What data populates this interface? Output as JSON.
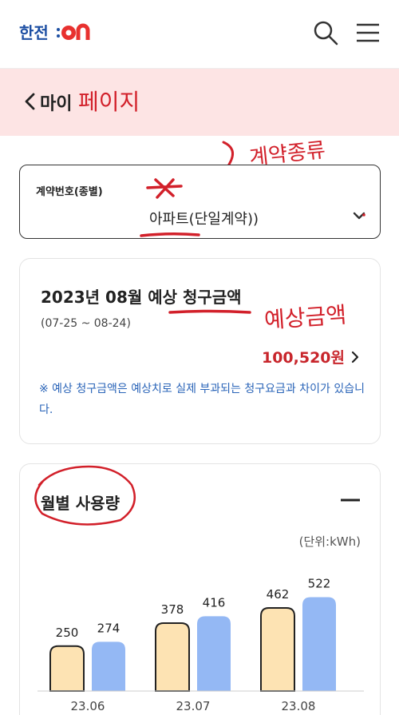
{
  "header": {
    "logo": {
      "part1": "한전",
      "part2": "ON"
    },
    "search_icon": "search-icon",
    "menu_icon": "hamburger-menu-icon"
  },
  "page": {
    "title": "마이",
    "back_icon": "chevron-left-icon"
  },
  "annotations": {
    "title_scribble": "페이지",
    "contract_scribble": "계약종류",
    "bill_scribble": "예상금액"
  },
  "contract": {
    "label": "계약번호(종별)",
    "value": "아파트(단일계약))",
    "dropdown_icon": "chevron-down-icon"
  },
  "bill": {
    "title": "2023년 08월 예상 청구금액",
    "period": "(07-25 ~ 08-24)",
    "amount": "100,520원",
    "note": "※ 예상 청구금액은 예상치로 실제 부과되는 청구요금과 차이가 있습니다."
  },
  "usage": {
    "title": "월별 사용량",
    "unit": "(단위:kWh)",
    "collapse_icon": "minus-icon"
  },
  "colors": {
    "accent_red": "#c8262c",
    "note_blue": "#2a64b8",
    "bar_prev_year": "#fde3b3",
    "bar_this_year": "#94b8f4",
    "title_band": "#fde4e4"
  },
  "chart_data": {
    "type": "bar",
    "categories": [
      "23.06",
      "23.07",
      "23.08"
    ],
    "series": [
      {
        "values": [
          250,
          378,
          462
        ]
      },
      {
        "values": [
          274,
          416,
          522
        ]
      }
    ],
    "ylabel": "(단위:kWh)",
    "title": "월별 사용량",
    "grid": false
  }
}
